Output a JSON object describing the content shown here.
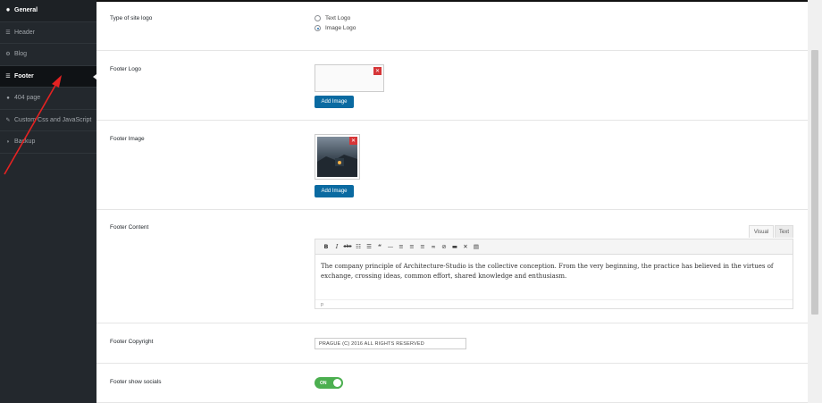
{
  "sidebar": {
    "items": [
      {
        "label": "General",
        "icon": "gear-icon"
      },
      {
        "label": "Header",
        "icon": "bars-icon"
      },
      {
        "label": "Blog",
        "icon": "cogs-icon"
      },
      {
        "label": "Footer",
        "icon": "bars-icon"
      },
      {
        "label": "404 page",
        "icon": "info-circle-icon"
      },
      {
        "label": "Custom Css and JavaScript",
        "icon": "pencil-icon"
      },
      {
        "label": "Backup",
        "icon": "shield-icon"
      }
    ]
  },
  "settings": {
    "logo_type": {
      "label": "Type of site logo",
      "options": [
        "Text Logo",
        "Image Logo"
      ],
      "selected": "Image Logo"
    },
    "footer_logo": {
      "label": "Footer Logo",
      "button": "Add Image"
    },
    "footer_image": {
      "label": "Footer Image",
      "button": "Add Image"
    },
    "footer_content": {
      "label": "Footer Content",
      "tab_visual": "Visual",
      "tab_text": "Text",
      "text": "The company principle of Architecture-Studio is the collective conception. From the very beginning, the practice has believed in the virtues of exchange, crossing ideas, common effort, shared knowledge and enthusiasm.",
      "status": "p"
    },
    "footer_copyright": {
      "label": "Footer Copyright",
      "value": "PRAGUE (C) 2016 ALL RIGHTS RESERVED"
    },
    "footer_socials": {
      "label": "Footer show socials",
      "toggle": "ON"
    }
  },
  "toolbar_icons": [
    "bold-icon",
    "italic-icon",
    "strikethrough-icon",
    "bulleted-list-icon",
    "numbered-list-icon",
    "blockquote-icon",
    "horizontal-rule-icon",
    "align-left-icon",
    "align-center-icon",
    "align-right-icon",
    "link-icon",
    "unlink-icon",
    "read-more-icon",
    "fullscreen-icon",
    "toolbar-toggle-icon"
  ],
  "colors": {
    "sidebar_bg": "#23282d",
    "button_blue": "#0a6aa1",
    "toggle_green": "#4caf50",
    "arrow_red": "#e52222",
    "delete_red": "#d63638"
  }
}
